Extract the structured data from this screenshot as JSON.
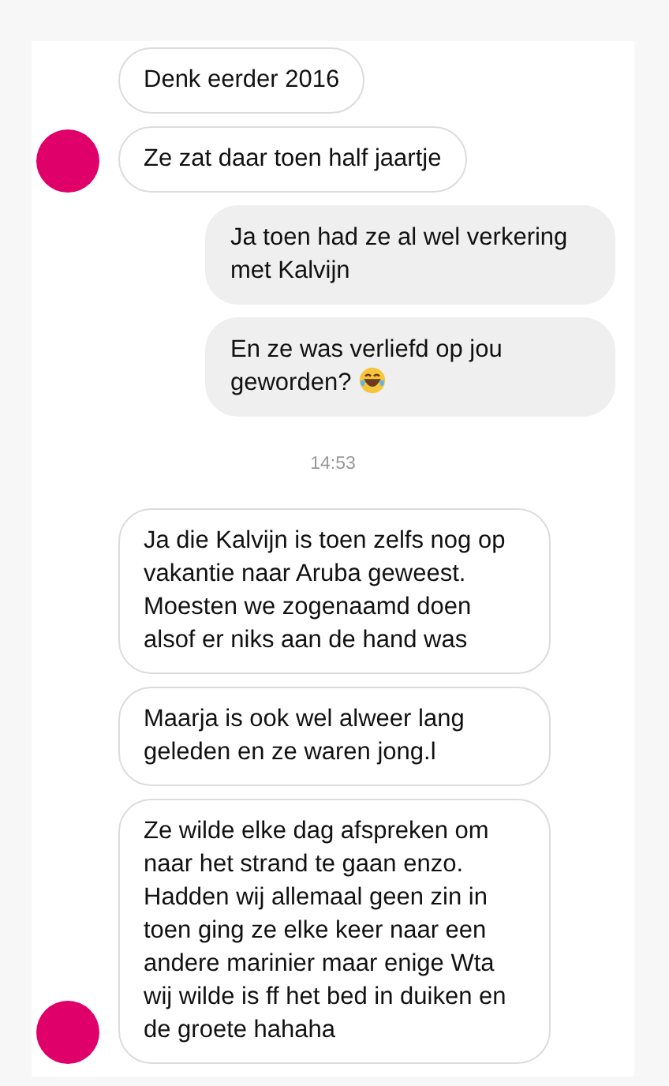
{
  "messages": [
    {
      "kind": "received",
      "text": "Denk eerder 2016",
      "avatar": false
    },
    {
      "kind": "received",
      "text": "Ze zat daar toen half jaartje",
      "avatar": true
    },
    {
      "kind": "sent",
      "text": "Ja toen had ze al wel verkering met Kalvijn"
    },
    {
      "kind": "sent",
      "text": "En ze was verliefd op jou geworden?",
      "emoji": true
    },
    {
      "kind": "time",
      "text": "14:53"
    },
    {
      "kind": "received",
      "text": "Ja die Kalvijn is toen zelfs nog op vakantie naar Aruba geweest. Moesten we zogenaamd doen alsof er niks aan de hand was",
      "avatar": false
    },
    {
      "kind": "received",
      "text": "Maarja is ook wel alweer lang geleden en ze waren jong.l",
      "avatar": false
    },
    {
      "kind": "received",
      "text": "Ze wilde elke dag afspreken om naar het strand te gaan enzo. Hadden wij allemaal geen zin in toen ging ze elke keer naar een andere marinier maar enige Wta wij wilde is ff het bed in duiken en de groete hahaha",
      "avatar": true
    }
  ]
}
